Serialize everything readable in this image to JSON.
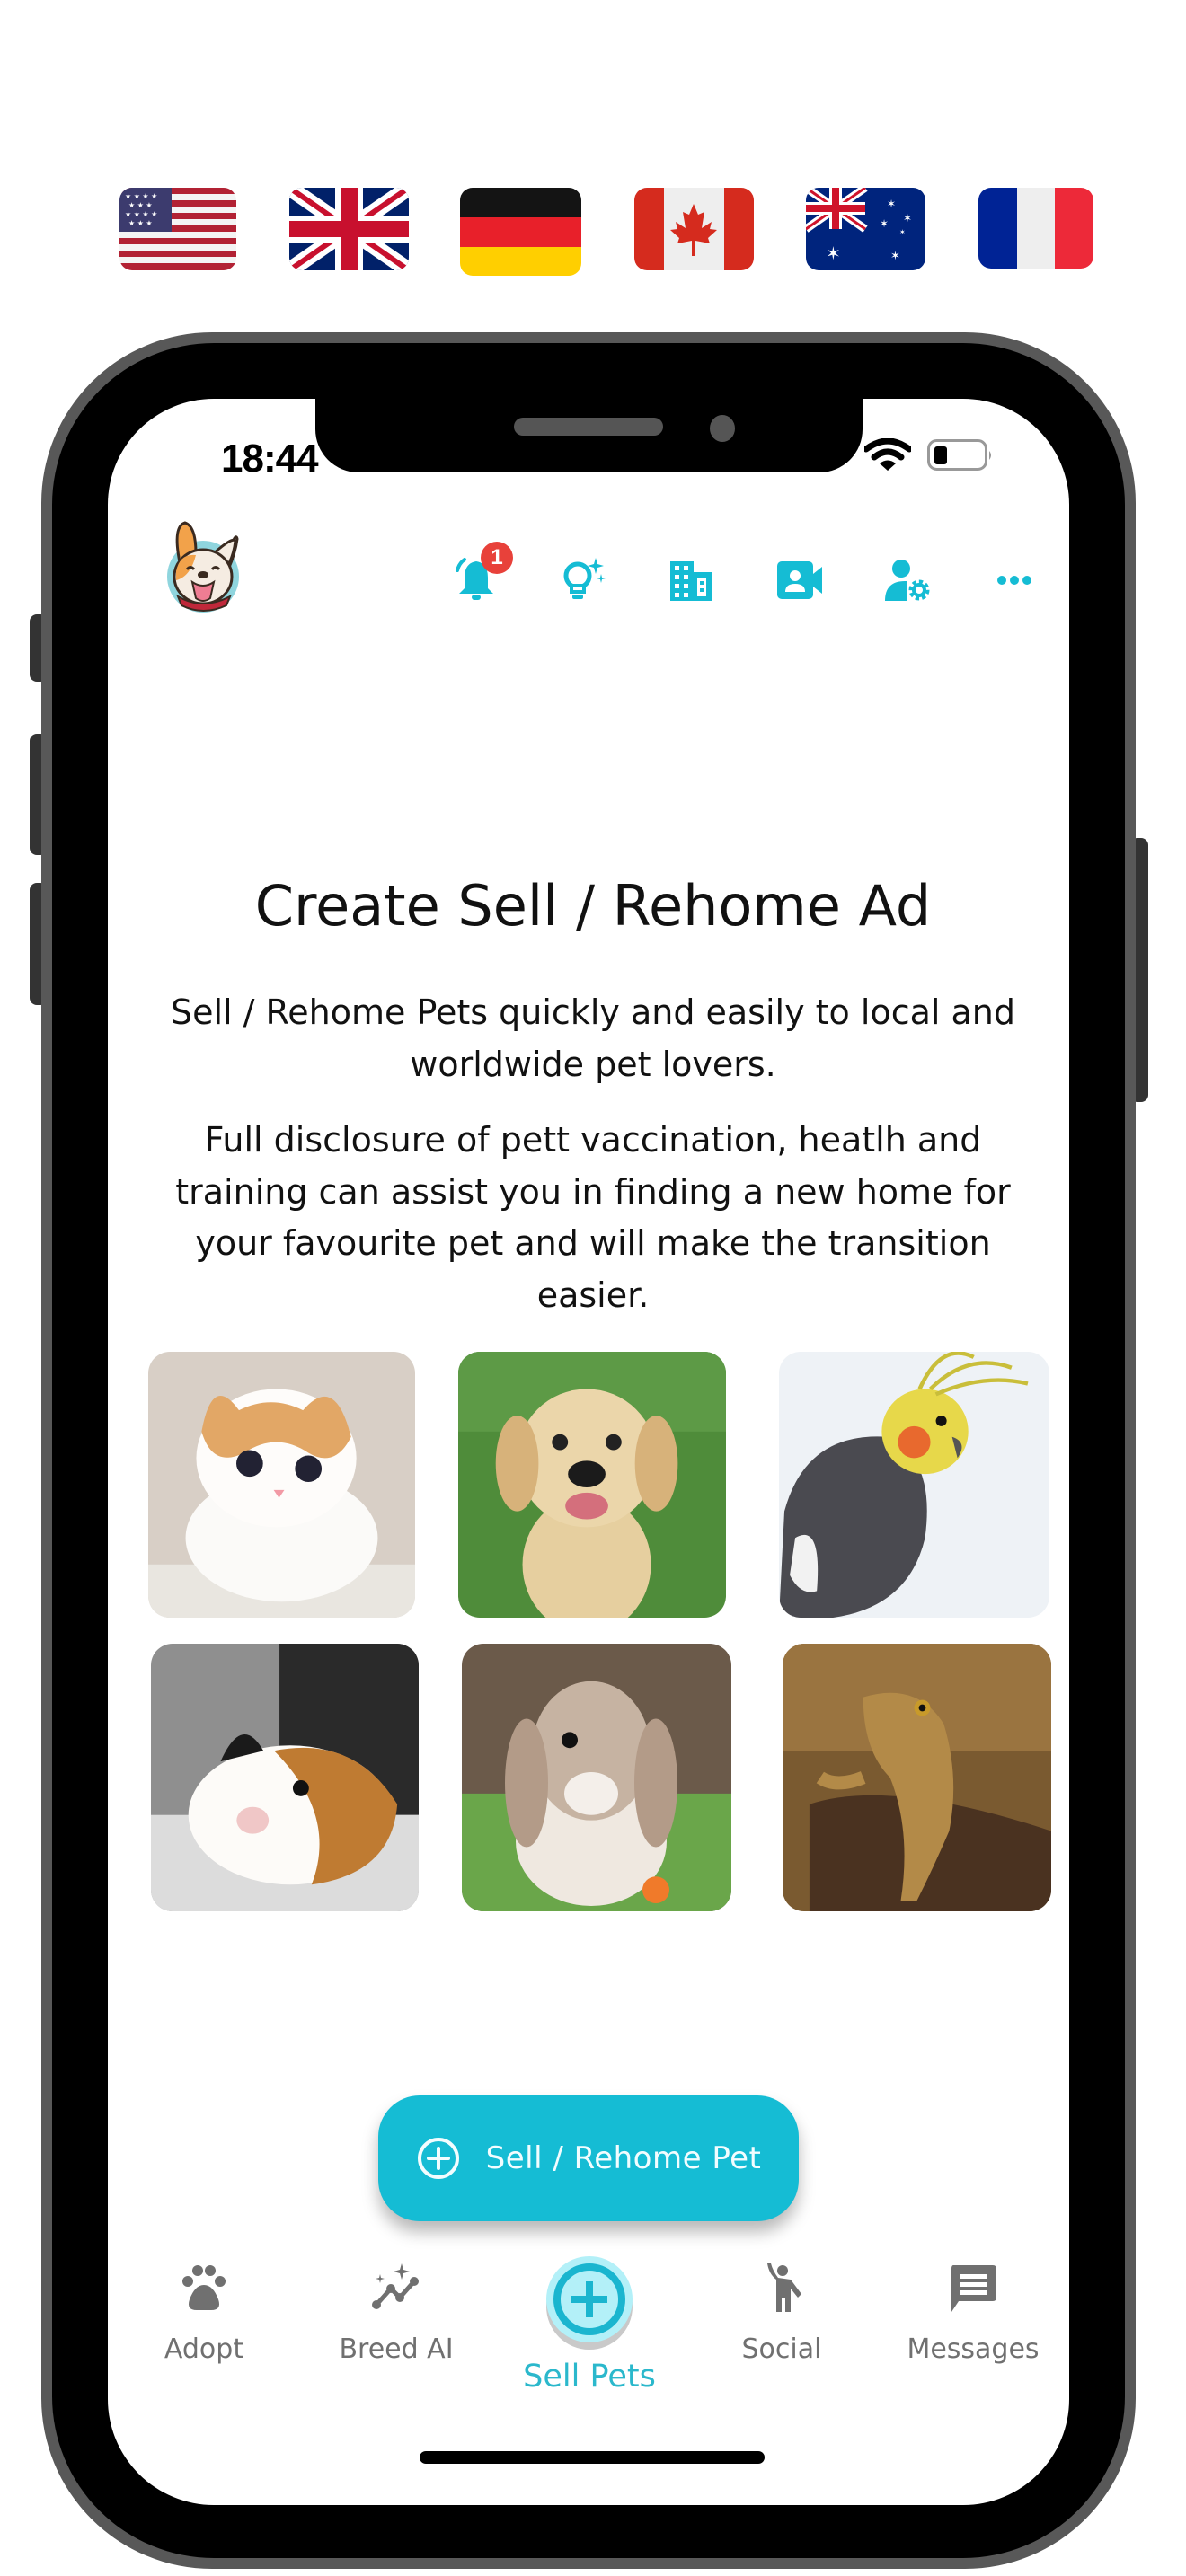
{
  "flags": [
    {
      "name": "United States",
      "icon": "flag-us-icon"
    },
    {
      "name": "United Kingdom",
      "icon": "flag-uk-icon"
    },
    {
      "name": "Germany",
      "icon": "flag-de-icon"
    },
    {
      "name": "Canada",
      "icon": "flag-ca-icon"
    },
    {
      "name": "Australia",
      "icon": "flag-au-icon"
    },
    {
      "name": "France",
      "icon": "flag-fr-icon"
    }
  ],
  "status_bar": {
    "time": "18:44",
    "wifi_icon": "wifi-icon",
    "battery_icon": "battery-low-icon",
    "battery_level": 0.2
  },
  "header": {
    "avatar_icon": "dog-avatar-icon",
    "notification_count": "1",
    "icons": [
      "bell-icon",
      "lightbulb-sparkle-icon",
      "building-icon",
      "video-contact-icon",
      "person-gear-icon",
      "more-horizontal-icon"
    ]
  },
  "main": {
    "title": "Create Sell / Rehome Ad",
    "paragraph1": "Sell / Rehome Pets quickly and easily to local and worldwide pet lovers.",
    "paragraph2": "Full disclosure of pett vaccination, heatlh and training can assist you in finding a new home for your favourite pet and will make the transition easier.",
    "pets": [
      "Kitten",
      "Puppy",
      "Cockatiel",
      "Guinea pig",
      "Rabbit",
      "Bearded dragon"
    ],
    "cta_label": "Sell / Rehome Pet"
  },
  "bottom_nav": {
    "items": [
      {
        "label": "Adopt",
        "icon": "paw-icon",
        "active": false
      },
      {
        "label": "Breed AI",
        "icon": "sparkle-chart-icon",
        "active": false
      },
      {
        "label": "Sell Pets",
        "icon": "plus-circle-icon",
        "active": true
      },
      {
        "label": "Social",
        "icon": "person-waving-icon",
        "active": false
      },
      {
        "label": "Messages",
        "icon": "chat-icon",
        "active": false
      }
    ]
  },
  "colors": {
    "accent": "#15bcd4",
    "accent_light": "#b3f0f8",
    "inactive_nav": "#707070",
    "badge": "#e8413a"
  }
}
